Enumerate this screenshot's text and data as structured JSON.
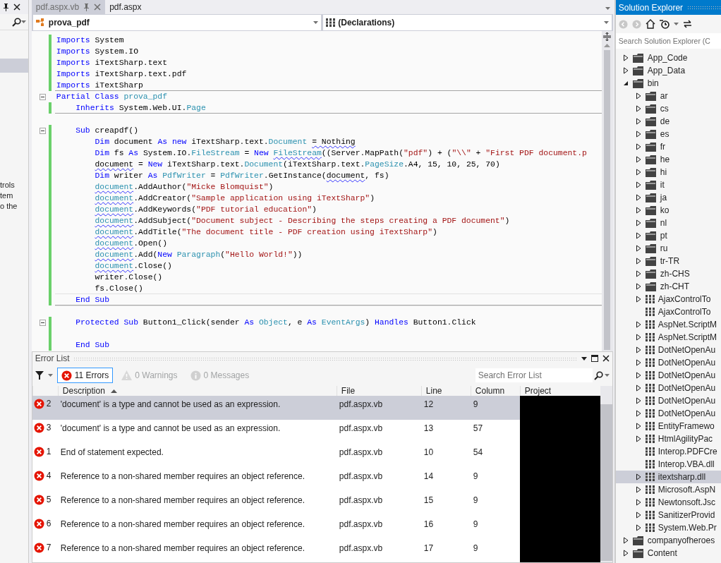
{
  "left_panel": {
    "text_lines": [
      "trols",
      "tem",
      "o the"
    ]
  },
  "tabs": [
    {
      "label": "pdf.aspx.vb",
      "selected": true
    },
    {
      "label": "pdf.aspx",
      "selected": false
    }
  ],
  "navigation": {
    "class_dropdown": "prova_pdf",
    "member_dropdown": "(Declarations)"
  },
  "code_lines": [
    {
      "changed": true,
      "fold": false,
      "rule_below": false,
      "current": false,
      "tokens": [
        {
          "text": "Imports",
          "kind": "keyword"
        },
        {
          "text": " System",
          "kind": "plain"
        }
      ]
    },
    {
      "changed": true,
      "fold": false,
      "rule_below": false,
      "current": false,
      "tokens": [
        {
          "text": "Imports",
          "kind": "keyword"
        },
        {
          "text": " System.IO",
          "kind": "plain"
        }
      ]
    },
    {
      "changed": true,
      "fold": false,
      "rule_below": false,
      "current": false,
      "tokens": [
        {
          "text": "Imports",
          "kind": "keyword"
        },
        {
          "text": " iTextSharp.text",
          "kind": "plain"
        }
      ]
    },
    {
      "changed": true,
      "fold": false,
      "rule_below": false,
      "current": false,
      "tokens": [
        {
          "text": "Imports",
          "kind": "keyword"
        },
        {
          "text": " iTextSharp.text.pdf",
          "kind": "plain"
        }
      ]
    },
    {
      "changed": true,
      "fold": false,
      "rule_below": true,
      "current": false,
      "tokens": [
        {
          "text": "Imports",
          "kind": "keyword"
        },
        {
          "text": " iTextSharp",
          "kind": "plain"
        }
      ]
    },
    {
      "changed": false,
      "fold": true,
      "rule_below": false,
      "current": false,
      "tokens": [
        {
          "text": "Partial Class",
          "kind": "keyword"
        },
        {
          "text": " prova_pdf",
          "kind": "type"
        }
      ]
    },
    {
      "changed": true,
      "fold": false,
      "rule_below": true,
      "current": false,
      "tokens": [
        {
          "text": "    Inherits",
          "kind": "keyword"
        },
        {
          "text": " System.Web.UI.",
          "kind": "plain"
        },
        {
          "text": "Page",
          "kind": "type"
        }
      ]
    },
    {
      "changed": false,
      "fold": false,
      "rule_below": false,
      "current": false
    },
    {
      "changed": true,
      "fold": true,
      "rule_below": false,
      "current": false,
      "tokens": [
        {
          "text": "    Sub",
          "kind": "keyword"
        },
        {
          "text": " creapdf()",
          "kind": "plain"
        }
      ]
    },
    {
      "changed": true,
      "fold": false,
      "rule_below": false,
      "current": false,
      "tokens": [
        {
          "text": "        Dim",
          "kind": "keyword"
        },
        {
          "text": " document ",
          "kind": "plain"
        },
        {
          "text": "As new",
          "kind": "keyword"
        },
        {
          "text": " iTextSharp.text.",
          "kind": "plain"
        },
        {
          "text": "Document ",
          "kind": "type"
        },
        {
          "text": "= Nothing",
          "kind": "plain",
          "squiggle": true
        }
      ]
    },
    {
      "changed": true,
      "fold": false,
      "rule_below": false,
      "current": false,
      "tokens": [
        {
          "text": "        Dim",
          "kind": "keyword"
        },
        {
          "text": " fs ",
          "kind": "plain"
        },
        {
          "text": "As",
          "kind": "keyword"
        },
        {
          "text": " System.IO.",
          "kind": "plain"
        },
        {
          "text": "FileStream",
          "kind": "type"
        },
        {
          "text": " = ",
          "kind": "plain"
        },
        {
          "text": "New ",
          "kind": "keyword"
        },
        {
          "text": "FileStream",
          "kind": "type",
          "squiggle": true
        },
        {
          "text": "((Server.MapPath(",
          "kind": "plain"
        },
        {
          "text": "\"pdf\"",
          "kind": "string"
        },
        {
          "text": ") + (",
          "kind": "plain"
        },
        {
          "text": "\"\\\\\"",
          "kind": "string"
        },
        {
          "text": " + ",
          "kind": "plain"
        },
        {
          "text": "\"First PDF document.p",
          "kind": "string"
        }
      ]
    },
    {
      "changed": true,
      "fold": false,
      "rule_below": false,
      "current": false,
      "tokens": [
        {
          "text": "        document",
          "kind": "plain",
          "squiggle": true
        },
        {
          "text": " = ",
          "kind": "plain"
        },
        {
          "text": "New",
          "kind": "keyword"
        },
        {
          "text": " iTextSharp.text.",
          "kind": "plain"
        },
        {
          "text": "Document",
          "kind": "type"
        },
        {
          "text": "(iTextSharp.text.",
          "kind": "plain"
        },
        {
          "text": "PageSize",
          "kind": "type"
        },
        {
          "text": ".A4, 15, 10, 25, 70)",
          "kind": "plain"
        }
      ]
    },
    {
      "changed": true,
      "fold": false,
      "rule_below": false,
      "current": false,
      "tokens": [
        {
          "text": "        Dim",
          "kind": "keyword"
        },
        {
          "text": " writer ",
          "kind": "plain"
        },
        {
          "text": "As ",
          "kind": "keyword"
        },
        {
          "text": "PdfWriter",
          "kind": "type"
        },
        {
          "text": " = ",
          "kind": "plain"
        },
        {
          "text": "PdfWriter",
          "kind": "type"
        },
        {
          "text": ".GetInstance(",
          "kind": "plain"
        },
        {
          "text": "document",
          "kind": "plain",
          "squiggle": true
        },
        {
          "text": ", fs)",
          "kind": "plain"
        }
      ]
    },
    {
      "changed": true,
      "fold": false,
      "rule_below": false,
      "current": false,
      "tokens": [
        {
          "text": "        document",
          "kind": "type",
          "squiggle": true
        },
        {
          "text": ".AddAuthor(",
          "kind": "plain"
        },
        {
          "text": "\"Micke Blomquist\"",
          "kind": "string"
        },
        {
          "text": ")",
          "kind": "plain"
        }
      ]
    },
    {
      "changed": true,
      "fold": false,
      "rule_below": false,
      "current": false,
      "tokens": [
        {
          "text": "        document",
          "kind": "type",
          "squiggle": true
        },
        {
          "text": ".AddCreator(",
          "kind": "plain"
        },
        {
          "text": "\"Sample application using iTextSharp\"",
          "kind": "string"
        },
        {
          "text": ")",
          "kind": "plain"
        }
      ]
    },
    {
      "changed": true,
      "fold": false,
      "rule_below": false,
      "current": false,
      "tokens": [
        {
          "text": "        document",
          "kind": "type",
          "squiggle": true
        },
        {
          "text": ".AddKeywords(",
          "kind": "plain"
        },
        {
          "text": "\"PDF tutorial education\"",
          "kind": "string"
        },
        {
          "text": ")",
          "kind": "plain"
        }
      ]
    },
    {
      "changed": true,
      "fold": false,
      "rule_below": false,
      "current": false,
      "tokens": [
        {
          "text": "        document",
          "kind": "type",
          "squiggle": true
        },
        {
          "text": ".AddSubject(",
          "kind": "plain"
        },
        {
          "text": "\"Document subject - Describing the steps creating a PDF document\"",
          "kind": "string"
        },
        {
          "text": ")",
          "kind": "plain"
        }
      ]
    },
    {
      "changed": true,
      "fold": false,
      "rule_below": false,
      "current": false,
      "tokens": [
        {
          "text": "        document",
          "kind": "type",
          "squiggle": true
        },
        {
          "text": ".AddTitle(",
          "kind": "plain"
        },
        {
          "text": "\"The document title - PDF creation using iTextSharp\"",
          "kind": "string"
        },
        {
          "text": ")",
          "kind": "plain"
        }
      ]
    },
    {
      "changed": true,
      "fold": false,
      "rule_below": false,
      "current": false,
      "tokens": [
        {
          "text": "        document",
          "kind": "type",
          "squiggle": true
        },
        {
          "text": ".Open()",
          "kind": "plain"
        }
      ]
    },
    {
      "changed": true,
      "fold": false,
      "rule_below": false,
      "current": false,
      "tokens": [
        {
          "text": "        document",
          "kind": "type",
          "squiggle": true
        },
        {
          "text": ".Add(",
          "kind": "plain"
        },
        {
          "text": "New ",
          "kind": "keyword"
        },
        {
          "text": "Paragraph",
          "kind": "type"
        },
        {
          "text": "(",
          "kind": "plain"
        },
        {
          "text": "\"Hello World!\"",
          "kind": "string"
        },
        {
          "text": "))",
          "kind": "plain"
        }
      ]
    },
    {
      "changed": true,
      "fold": false,
      "rule_below": false,
      "current": false,
      "tokens": [
        {
          "text": "        document",
          "kind": "type",
          "squiggle": true
        },
        {
          "text": ".Close()",
          "kind": "plain"
        }
      ]
    },
    {
      "changed": true,
      "fold": false,
      "rule_below": false,
      "current": false,
      "tokens": [
        {
          "text": "        writer.Close()",
          "kind": "plain"
        }
      ]
    },
    {
      "changed": true,
      "fold": false,
      "rule_below": false,
      "current": false,
      "tokens": [
        {
          "text": "        fs.Close()",
          "kind": "plain"
        }
      ]
    },
    {
      "changed": true,
      "fold": false,
      "rule_below": true,
      "current": true,
      "tokens": [
        {
          "text": "    End Sub",
          "kind": "keyword"
        }
      ]
    },
    {
      "changed": false,
      "fold": false,
      "rule_below": false,
      "current": false
    },
    {
      "changed": true,
      "fold": true,
      "rule_below": false,
      "current": false,
      "tokens": [
        {
          "text": "    Protected Sub",
          "kind": "keyword"
        },
        {
          "text": " Button1_Click(sender ",
          "kind": "plain"
        },
        {
          "text": "As ",
          "kind": "keyword"
        },
        {
          "text": "Object",
          "kind": "type"
        },
        {
          "text": ", e ",
          "kind": "plain"
        },
        {
          "text": "As ",
          "kind": "keyword"
        },
        {
          "text": "EventArgs",
          "kind": "type"
        },
        {
          "text": ") ",
          "kind": "plain"
        },
        {
          "text": "Handles",
          "kind": "keyword"
        },
        {
          "text": " Button1.Click",
          "kind": "plain"
        }
      ]
    },
    {
      "changed": true,
      "fold": false,
      "rule_below": false,
      "current": false
    },
    {
      "changed": true,
      "fold": false,
      "rule_below": false,
      "current": false,
      "tokens": [
        {
          "text": "    End Sub",
          "kind": "keyword"
        }
      ]
    }
  ],
  "error_list": {
    "title": "Error List",
    "filters": [
      {
        "label": "11 Errors",
        "kind": "errors",
        "selected": true,
        "disabled": false
      },
      {
        "label": "0 Warnings",
        "kind": "warnings",
        "selected": false,
        "disabled": true
      },
      {
        "label": "0 Messages",
        "kind": "messages",
        "selected": false,
        "disabled": true
      }
    ],
    "search": {
      "placeholder": "Search Error List"
    },
    "columns": [
      {
        "label": "Description",
        "sorted": true
      },
      {
        "label": "File",
        "sorted": false
      },
      {
        "label": "Line",
        "sorted": false
      },
      {
        "label": "Column",
        "sorted": false
      },
      {
        "label": "Project",
        "sorted": false
      }
    ],
    "rows": [
      {
        "number": "2",
        "description": "'document' is a type and cannot be used as an expression.",
        "file": "pdf.aspx.vb",
        "line": "12",
        "column": "9",
        "selected": true
      },
      {
        "number": "3",
        "description": "'document' is a type and cannot be used as an expression.",
        "file": "pdf.aspx.vb",
        "line": "13",
        "column": "57",
        "selected": false
      },
      {
        "number": "1",
        "description": "End of statement expected.",
        "file": "pdf.aspx.vb",
        "line": "10",
        "column": "54",
        "selected": false
      },
      {
        "number": "4",
        "description": "Reference to a non-shared member requires an object reference.",
        "file": "pdf.aspx.vb",
        "line": "14",
        "column": "9",
        "selected": false
      },
      {
        "number": "5",
        "description": "Reference to a non-shared member requires an object reference.",
        "file": "pdf.aspx.vb",
        "line": "15",
        "column": "9",
        "selected": false
      },
      {
        "number": "6",
        "description": "Reference to a non-shared member requires an object reference.",
        "file": "pdf.aspx.vb",
        "line": "16",
        "column": "9",
        "selected": false
      },
      {
        "number": "7",
        "description": "Reference to a non-shared member requires an object reference.",
        "file": "pdf.aspx.vb",
        "line": "17",
        "column": "9",
        "selected": false
      }
    ]
  },
  "solution_explorer": {
    "title": "Solution Explorer",
    "search": {
      "placeholder": "Search Solution Explorer (C"
    },
    "items": [
      {
        "label": "App_Code",
        "kind": "folder",
        "has_children": true,
        "expanded": false,
        "selected": false
      },
      {
        "label": "App_Data",
        "kind": "folder",
        "has_children": true,
        "expanded": false,
        "selected": false
      },
      {
        "label": "bin",
        "kind": "folder",
        "has_children": true,
        "expanded": true,
        "selected": false,
        "children": [
          {
            "label": "ar",
            "kind": "folder",
            "has_children": true,
            "expanded": false,
            "selected": false
          },
          {
            "label": "cs",
            "kind": "folder",
            "has_children": true,
            "expanded": false,
            "selected": false
          },
          {
            "label": "de",
            "kind": "folder",
            "has_children": true,
            "expanded": false,
            "selected": false
          },
          {
            "label": "es",
            "kind": "folder",
            "has_children": true,
            "expanded": false,
            "selected": false
          },
          {
            "label": "fr",
            "kind": "folder",
            "has_children": true,
            "expanded": false,
            "selected": false
          },
          {
            "label": "he",
            "kind": "folder",
            "has_children": true,
            "expanded": false,
            "selected": false
          },
          {
            "label": "hi",
            "kind": "folder",
            "has_children": true,
            "expanded": false,
            "selected": false
          },
          {
            "label": "it",
            "kind": "folder",
            "has_children": true,
            "expanded": false,
            "selected": false
          },
          {
            "label": "ja",
            "kind": "folder",
            "has_children": true,
            "expanded": false,
            "selected": false
          },
          {
            "label": "ko",
            "kind": "folder",
            "has_children": true,
            "expanded": false,
            "selected": false
          },
          {
            "label": "nl",
            "kind": "folder",
            "has_children": true,
            "expanded": false,
            "selected": false
          },
          {
            "label": "pt",
            "kind": "folder",
            "has_children": true,
            "expanded": false,
            "selected": false
          },
          {
            "label": "ru",
            "kind": "folder",
            "has_children": true,
            "expanded": false,
            "selected": false
          },
          {
            "label": "tr-TR",
            "kind": "folder",
            "has_children": true,
            "expanded": false,
            "selected": false
          },
          {
            "label": "zh-CHS",
            "kind": "folder",
            "has_children": true,
            "expanded": false,
            "selected": false
          },
          {
            "label": "zh-CHT",
            "kind": "folder",
            "has_children": true,
            "expanded": false,
            "selected": false
          },
          {
            "label": "AjaxControlTo",
            "kind": "assembly",
            "has_children": true,
            "expanded": false,
            "selected": false
          },
          {
            "label": "AjaxControlTo",
            "kind": "assembly",
            "has_children": false,
            "expanded": false,
            "selected": false
          },
          {
            "label": "AspNet.ScriptM",
            "kind": "assembly",
            "has_children": true,
            "expanded": false,
            "selected": false
          },
          {
            "label": "AspNet.ScriptM",
            "kind": "assembly",
            "has_children": true,
            "expanded": false,
            "selected": false
          },
          {
            "label": "DotNetOpenAu",
            "kind": "assembly",
            "has_children": true,
            "expanded": false,
            "selected": false
          },
          {
            "label": "DotNetOpenAu",
            "kind": "assembly",
            "has_children": true,
            "expanded": false,
            "selected": false
          },
          {
            "label": "DotNetOpenAu",
            "kind": "assembly",
            "has_children": true,
            "expanded": false,
            "selected": false
          },
          {
            "label": "DotNetOpenAu",
            "kind": "assembly",
            "has_children": true,
            "expanded": false,
            "selected": false
          },
          {
            "label": "DotNetOpenAu",
            "kind": "assembly",
            "has_children": true,
            "expanded": false,
            "selected": false
          },
          {
            "label": "DotNetOpenAu",
            "kind": "assembly",
            "has_children": true,
            "expanded": false,
            "selected": false
          },
          {
            "label": "EntityFramewo",
            "kind": "assembly",
            "has_children": true,
            "expanded": false,
            "selected": false
          },
          {
            "label": "HtmlAgilityPac",
            "kind": "assembly",
            "has_children": true,
            "expanded": false,
            "selected": false
          },
          {
            "label": "Interop.PDFCre",
            "kind": "assembly",
            "has_children": false,
            "expanded": false,
            "selected": false
          },
          {
            "label": "Interop.VBA.dll",
            "kind": "assembly",
            "has_children": false,
            "expanded": false,
            "selected": false
          },
          {
            "label": "itextsharp.dll",
            "kind": "assembly",
            "has_children": true,
            "expanded": false,
            "selected": true
          },
          {
            "label": "Microsoft.AspN",
            "kind": "assembly",
            "has_children": true,
            "expanded": false,
            "selected": false
          },
          {
            "label": "Newtonsoft.Jsc",
            "kind": "assembly",
            "has_children": true,
            "expanded": false,
            "selected": false
          },
          {
            "label": "SanitizerProvid",
            "kind": "assembly",
            "has_children": true,
            "expanded": false,
            "selected": false
          },
          {
            "label": "System.Web.Pr",
            "kind": "assembly",
            "has_children": true,
            "expanded": false,
            "selected": false
          }
        ]
      },
      {
        "label": "companyofheroes",
        "kind": "folder",
        "has_children": true,
        "expanded": false,
        "selected": false
      },
      {
        "label": "Content",
        "kind": "folder",
        "has_children": true,
        "expanded": false,
        "selected": false
      }
    ]
  }
}
